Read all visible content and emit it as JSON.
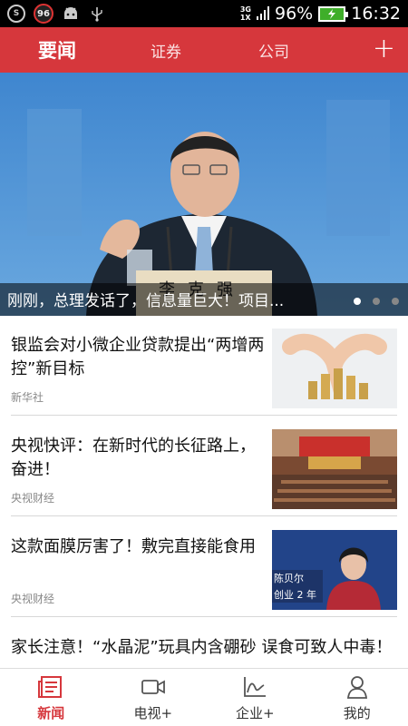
{
  "status_bar": {
    "badge_number": "96",
    "network": "3G",
    "network_sub": "1X",
    "battery_percent": "96%",
    "time": "16:32"
  },
  "top_nav": {
    "tabs": [
      "要闻",
      "证券",
      "公司"
    ],
    "active_tab": 0,
    "add_label": "+",
    "accent_color": "#d6373c"
  },
  "hero": {
    "caption": "刚刚，总理发话了，信息量巨大！项目...",
    "nameplate": "李克强",
    "slide_count": 3,
    "active_slide": 0
  },
  "news": [
    {
      "title": "银监会对小微企业贷款提出“两增两控”新目标",
      "source": "新华社",
      "thumb": "coins-heart-image"
    },
    {
      "title": "央视快评：在新时代的长征路上，奋进！",
      "source": "央视财经",
      "thumb": "assembly-hall-image"
    },
    {
      "title": "这款面膜厉害了！敷完直接能食用",
      "source": "央视财经",
      "thumb": "news-anchor-image",
      "thumb_text": "陈贝尔\n创业 2 年"
    },
    {
      "title": "家长注意！“水晶泥”玩具内含硼砂 误食可致人中毒！",
      "source": ""
    }
  ],
  "bottom_nav": {
    "items": [
      {
        "label": "新闻",
        "icon": "newspaper-icon"
      },
      {
        "label": "电视+",
        "icon": "video-camera-icon"
      },
      {
        "label": "企业+",
        "icon": "chart-icon"
      },
      {
        "label": "我的",
        "icon": "person-icon"
      }
    ],
    "active_index": 0
  }
}
